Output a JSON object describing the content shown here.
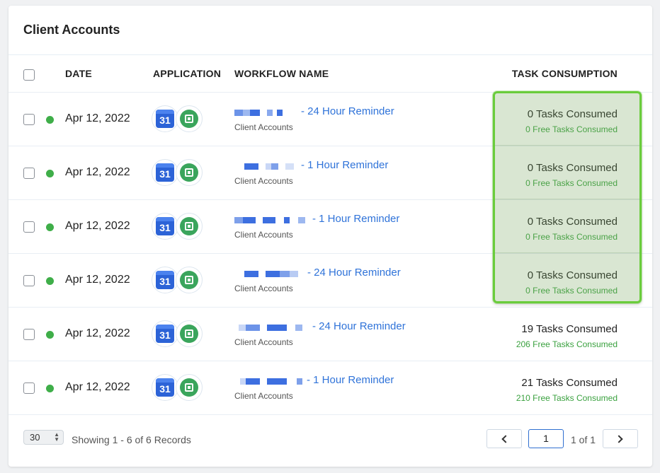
{
  "card": {
    "title": "Client Accounts"
  },
  "table": {
    "headers": {
      "date": "DATE",
      "application": "APPLICATION",
      "workflow": "WORKFLOW NAME",
      "tasks": "TASK CONSUMPTION"
    },
    "rows": [
      {
        "date": "Apr 12, 2022",
        "status": "active",
        "workflow_link": "- 24 Hour Reminder",
        "workflow_sub": "Client Accounts",
        "tasks": "0 Tasks Consumed",
        "free": "0 Free Tasks Consumed"
      },
      {
        "date": "Apr 12, 2022",
        "status": "active",
        "workflow_link": "- 1 Hour Reminder",
        "workflow_sub": "Client Accounts",
        "tasks": "0 Tasks Consumed",
        "free": "0 Free Tasks Consumed"
      },
      {
        "date": "Apr 12, 2022",
        "status": "active",
        "workflow_link": "- 1 Hour Reminder",
        "workflow_sub": "Client Accounts",
        "tasks": "0 Tasks Consumed",
        "free": "0 Free Tasks Consumed"
      },
      {
        "date": "Apr 12, 2022",
        "status": "active",
        "workflow_link": "- 24 Hour Reminder",
        "workflow_sub": "Client Accounts",
        "tasks": "0 Tasks Consumed",
        "free": "0 Free Tasks Consumed"
      },
      {
        "date": "Apr 12, 2022",
        "status": "active",
        "workflow_link": "- 24 Hour Reminder",
        "workflow_sub": "Client Accounts",
        "tasks": "19 Tasks Consumed",
        "free": "206 Free Tasks Consumed"
      },
      {
        "date": "Apr 12, 2022",
        "status": "active",
        "workflow_link": "- 1 Hour Reminder",
        "workflow_sub": "Client Accounts",
        "tasks": "21 Tasks Consumed",
        "free": "210 Free Tasks Consumed"
      }
    ],
    "app_icons": [
      "google-calendar-icon",
      "google-workspace-icon"
    ],
    "calendar_day": "31"
  },
  "footer": {
    "page_size": "30",
    "showing": "Showing 1 - 6 of 6 Records",
    "current_page": "1",
    "page_of": "1 of 1"
  },
  "colors": {
    "link": "#2f73d9",
    "status_active": "#3fae49",
    "free_tasks": "#3aa13f",
    "highlight_border": "#6acc3c"
  }
}
